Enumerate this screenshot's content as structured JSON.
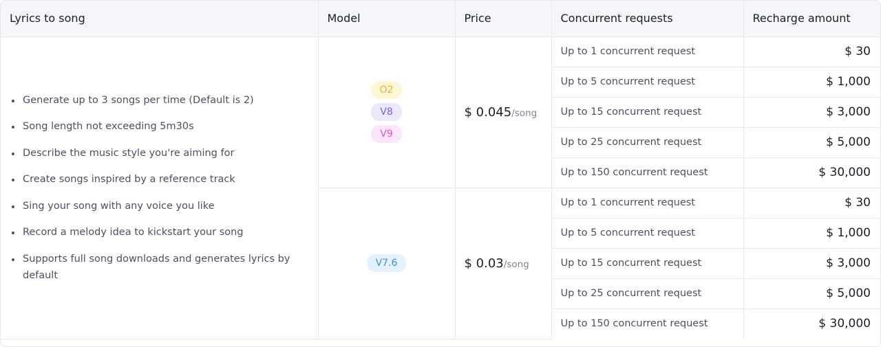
{
  "headers": {
    "feature": "Lyrics to song",
    "model": "Model",
    "price": "Price",
    "concurrent": "Concurrent requests",
    "recharge": "Recharge amount"
  },
  "features": [
    "Generate up to 3 songs per time (Default is 2)",
    "Song length not exceeding 5m30s",
    "Describe the music style you're aiming for",
    "Create songs inspired by a reference track",
    "Sing your song with any voice you like",
    "Record a melody idea to kickstart your song",
    "Supports full song downloads and generates lyrics by default"
  ],
  "groups": [
    {
      "models": [
        {
          "label": "O2",
          "color": "#e4b428",
          "bg": "#fdf7d8"
        },
        {
          "label": "V8",
          "color": "#7a5fe0",
          "bg": "#ece8fb"
        },
        {
          "label": "V9",
          "color": "#e24ee0",
          "bg": "#fbe6fb"
        }
      ],
      "price": "$ 0.045",
      "unit": "/song",
      "tiers": [
        {
          "requests": "Up to 1 concurrent request",
          "amount": "$ 30"
        },
        {
          "requests": "Up to 5 concurrent request",
          "amount": "$ 1,000"
        },
        {
          "requests": "Up to 15 concurrent request",
          "amount": "$ 3,000"
        },
        {
          "requests": "Up to 25 concurrent request",
          "amount": "$ 5,000"
        },
        {
          "requests": "Up to 150 concurrent request",
          "amount": "$ 30,000"
        }
      ]
    },
    {
      "models": [
        {
          "label": "V7.6",
          "color": "#3d8fe0",
          "bg": "#e4f2fd"
        }
      ],
      "price": "$ 0.03",
      "unit": "/song",
      "tiers": [
        {
          "requests": "Up to 1 concurrent request",
          "amount": "$ 30"
        },
        {
          "requests": "Up to 5 concurrent request",
          "amount": "$ 1,000"
        },
        {
          "requests": "Up to 15 concurrent request",
          "amount": "$ 3,000"
        },
        {
          "requests": "Up to 25 concurrent request",
          "amount": "$ 5,000"
        },
        {
          "requests": "Up to 150 concurrent request",
          "amount": "$ 30,000"
        }
      ]
    }
  ]
}
